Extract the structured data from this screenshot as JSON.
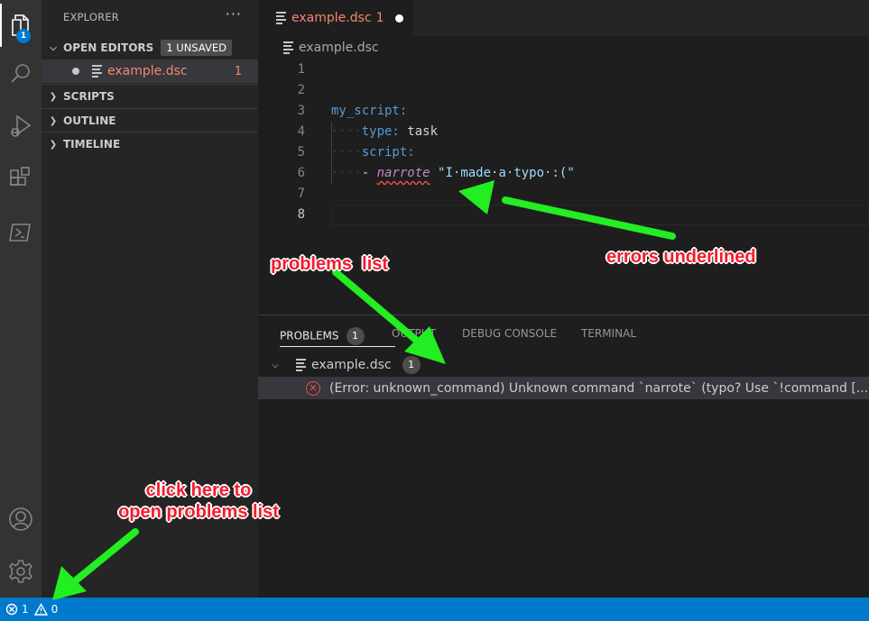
{
  "activity": {
    "explorer_badge": "1"
  },
  "sidebar": {
    "title": "EXPLORER",
    "more": "···",
    "open_editors": {
      "label": "OPEN EDITORS",
      "badge": "1 UNSAVED"
    },
    "open_file": {
      "name": "example.dsc",
      "problems": "1"
    },
    "sections": [
      "SCRIPTS",
      "OUTLINE",
      "TIMELINE"
    ]
  },
  "editor": {
    "tab": {
      "name": "example.dsc",
      "problems": "1"
    },
    "breadcrumb": "example.dsc",
    "current_line": 8,
    "lines": {
      "n": [
        "1",
        "2",
        "3",
        "4",
        "5",
        "6",
        "7",
        "8"
      ],
      "l3_key": "my_script:",
      "l4_ws": "····",
      "l4_key": "type:",
      "l4_val": " task",
      "l5_ws": "····",
      "l5_key": "script:",
      "l6_ws": "····",
      "l6_dash": "- ",
      "l6_cmd": "narrote",
      "l6_sp": " ",
      "l6_str": "\"I·made·a·typo·:(\""
    }
  },
  "panel": {
    "tabs": [
      "PROBLEMS",
      "OUTPUT",
      "DEBUG CONSOLE",
      "TERMINAL"
    ],
    "problems_count": "1",
    "file": {
      "name": "example.dsc",
      "count": "1"
    },
    "error_message": "(Error: unknown_command) Unknown command `narrote` (typo? Use `!command [...]` to"
  },
  "status": {
    "errors": "1",
    "warnings": "0"
  },
  "annotations": {
    "errors_underlined": "errors underlined",
    "problems_list": "problems  list",
    "click_here_line1": "click here to",
    "click_here_line2": "open problems list"
  },
  "colors": {
    "accent": "#007acc",
    "error": "#f48771",
    "arrow": "#22ee22",
    "annotation": "#f21c2e"
  }
}
